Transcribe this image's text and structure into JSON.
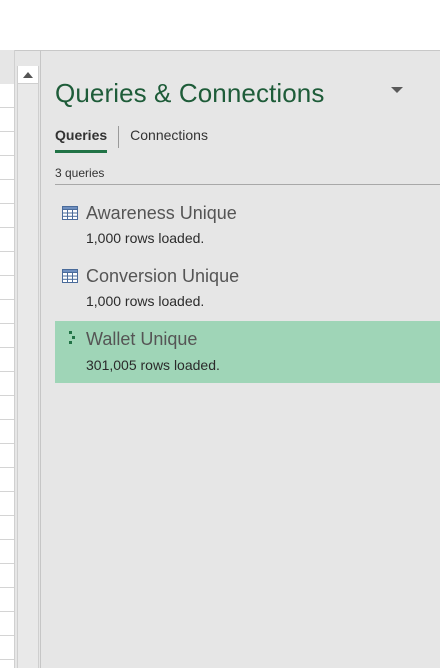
{
  "pane": {
    "title": "Queries & Connections",
    "menu_icon": "chevron-down-icon"
  },
  "tabs": [
    {
      "label": "Queries",
      "active": true
    },
    {
      "label": "Connections",
      "active": false
    }
  ],
  "query_count": "3 queries",
  "queries": [
    {
      "name": "Awareness Unique",
      "status": "1,000 rows loaded.",
      "icon": "table-icon",
      "selected": false
    },
    {
      "name": "Conversion Unique",
      "status": "1,000 rows loaded.",
      "icon": "table-icon",
      "selected": false
    },
    {
      "name": "Wallet Unique",
      "status": "301,005 rows loaded.",
      "icon": "loading-icon",
      "selected": true
    }
  ],
  "colors": {
    "title": "#1e5c39",
    "tab_underline": "#217346",
    "selected_row": "#9fd5b7",
    "pane_background": "#e6e6e6"
  }
}
